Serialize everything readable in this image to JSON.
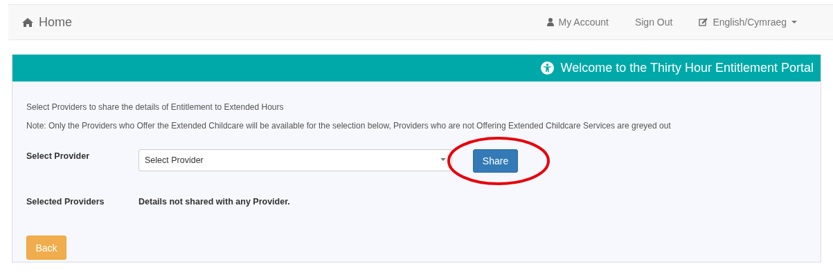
{
  "navbar": {
    "brand": "Home",
    "links": [
      {
        "kind": "account",
        "label": "My Account"
      },
      {
        "kind": "plain",
        "label": "Sign Out"
      },
      {
        "kind": "language",
        "label": "English/Cymraeg"
      }
    ]
  },
  "panel": {
    "title": "Welcome to the Thirty Hour Entitlement Portal",
    "intro": "Select Providers to share the details of Entitlement to Extended Hours",
    "note": "Note: Only the Providers who Offer the Extended Childcare will be available for the selection below, Providers who are not Offering Extended Childcare Services are greyed out",
    "select_label": "Select Provider",
    "select_value": "Select Provider",
    "share_button": "Share",
    "selected_label": "Selected Providers",
    "selected_value": "Details not shared with any Provider.",
    "back_button": "Back"
  }
}
